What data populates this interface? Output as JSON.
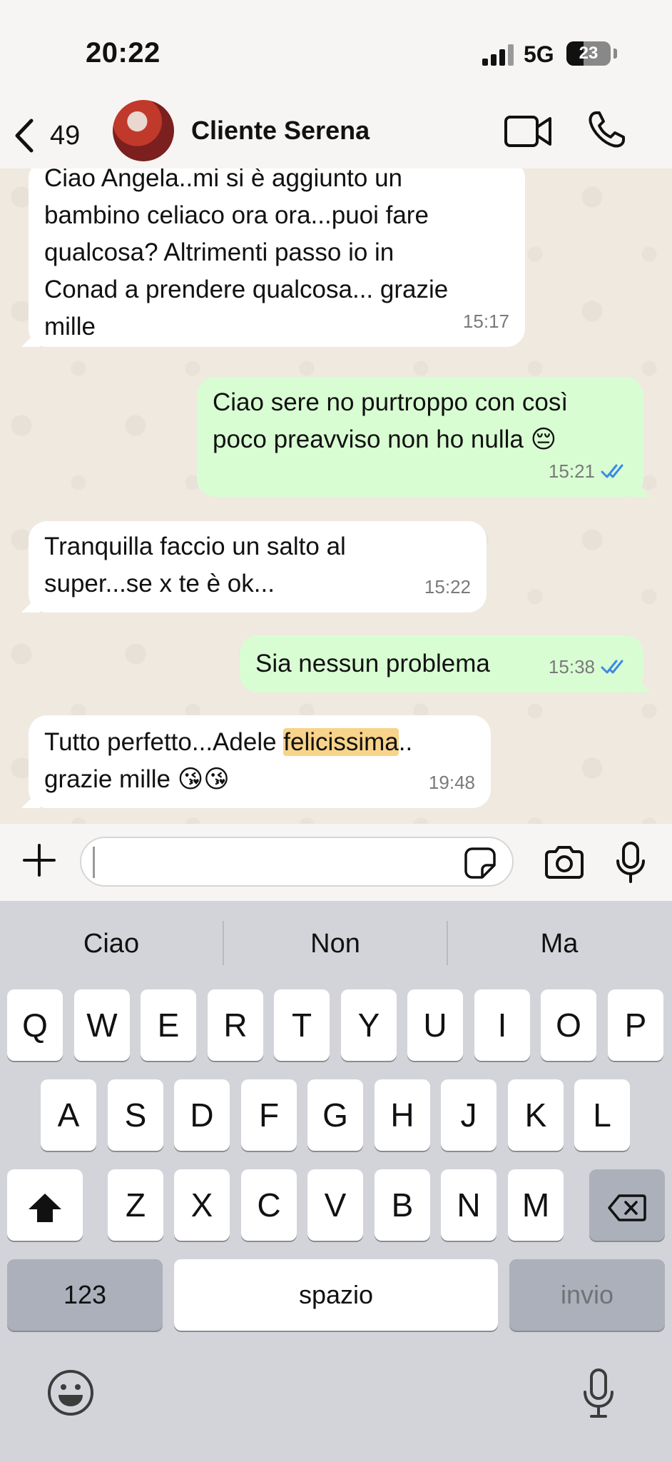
{
  "status_bar": {
    "time": "20:22",
    "network": "5G",
    "battery": "23"
  },
  "header": {
    "back_count": "49",
    "contact_name": "Cliente Serena"
  },
  "messages": [
    {
      "direction": "in",
      "text": "Ciao Angela..mi si è aggiunto un\nbambino celiaco ora ora...puoi fare\nqualcosa? Altrimenti passo io in\nConad a prendere qualcosa... grazie\nmille",
      "time": "15:17"
    },
    {
      "direction": "out",
      "text": "Ciao sere no purtroppo con così\npoco preavviso non ho nulla 😔",
      "time": "15:21",
      "status": "read"
    },
    {
      "direction": "in",
      "text": "Tranquilla faccio un salto al\nsuper...se x te è ok...",
      "time": "15:22"
    },
    {
      "direction": "out",
      "text": "Sia nessun problema",
      "time": "15:38",
      "status": "read"
    },
    {
      "direction": "in",
      "text_before": "Tutto perfetto...Adele ",
      "text_highlight": "felicissima",
      "text_after": "..\ngrazie mille 😘😘",
      "time": "19:48"
    }
  ],
  "input": {
    "value": "",
    "placeholder": ""
  },
  "keyboard": {
    "suggestions": [
      "Ciao",
      "Non",
      "Ma"
    ],
    "row1": [
      "Q",
      "W",
      "E",
      "R",
      "T",
      "Y",
      "U",
      "I",
      "O",
      "P"
    ],
    "row2": [
      "A",
      "S",
      "D",
      "F",
      "G",
      "H",
      "J",
      "K",
      "L"
    ],
    "row3": [
      "Z",
      "X",
      "C",
      "V",
      "B",
      "N",
      "M"
    ],
    "numbers_key": "123",
    "space_key": "spazio",
    "return_key": "invio"
  },
  "icons": {
    "back": "chevron-left-icon",
    "video": "video-camera-icon",
    "call": "phone-icon",
    "attach": "plus-icon",
    "sticker": "sticker-icon",
    "camera": "camera-icon",
    "mic": "microphone-icon",
    "shift": "shift-icon",
    "delete": "backspace-icon",
    "emoji": "emoji-icon",
    "read_ticks": "double-check-icon"
  },
  "colors": {
    "incoming_bubble": "#ffffff",
    "outgoing_bubble": "#d9fdd3",
    "read_ticks": "#3a8ae6",
    "highlight": "#f8d38a",
    "keyboard_bg": "#d2d4da"
  }
}
